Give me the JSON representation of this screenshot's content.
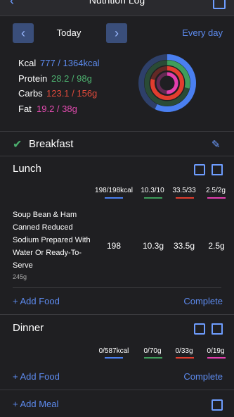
{
  "header": {
    "title": "Nutrition Log"
  },
  "date_nav": {
    "today_label": "Today",
    "every_day_label": "Every day",
    "prev_icon": "chevron-left-icon",
    "next_icon": "chevron-right-icon"
  },
  "macros": [
    {
      "label": "Kcal",
      "value": "777 / 1364kcal",
      "color": "#5d8bef"
    },
    {
      "label": "Protein",
      "value": "28.2 / 98g",
      "color": "#4caf6e"
    },
    {
      "label": "Carbs",
      "value": "123.1 / 156g",
      "color": "#e24a3b"
    },
    {
      "label": "Fat",
      "value": "19.2 / 38g",
      "color": "#e24bb0"
    }
  ],
  "rings": [
    {
      "name": "kcal",
      "fraction": 0.5697,
      "color": "#4a7ff0"
    },
    {
      "name": "protein",
      "fraction": 0.2878,
      "color": "#3f9d5b"
    },
    {
      "name": "carbs",
      "fraction": 0.7891,
      "color": "#e23d2f"
    },
    {
      "name": "fat",
      "fraction": 0.5053,
      "color": "#e43fae"
    }
  ],
  "breakfast": {
    "title": "Breakfast"
  },
  "lunch": {
    "title": "Lunch",
    "totals": [
      "198/198kcal",
      "10.3/10",
      "33.5/33",
      "2.5/2g"
    ],
    "food": {
      "name": "Soup Bean & Ham Canned Reduced Sodium Prepared With Water Or Ready-To-Serve",
      "weight": "245g",
      "values": [
        "198",
        "10.3g",
        "33.5g",
        "2.5g"
      ]
    },
    "add_food": "+ Add Food",
    "complete": "Complete"
  },
  "dinner": {
    "title": "Dinner",
    "totals": [
      "0/587kcal",
      "0/70g",
      "0/33g",
      "0/19g"
    ],
    "add_food": "+ Add Food",
    "complete": "Complete"
  },
  "footer": {
    "add_meal": "+ Add Meal"
  }
}
